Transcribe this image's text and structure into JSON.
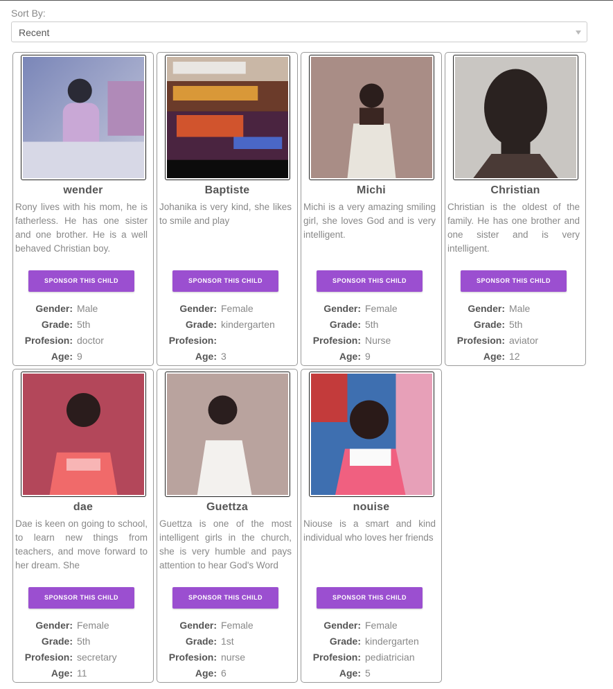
{
  "sort": {
    "label": "Sort By:",
    "selected": "Recent"
  },
  "labels": {
    "sponsor": "SPONSOR THIS CHILD",
    "gender": "Gender:",
    "grade": "Grade:",
    "profesion": "Profesion:",
    "age": "Age:"
  },
  "children": [
    {
      "name": "wender",
      "bio": "Rony lives with his mom, he is fatherless. He has one sister and one brother. He is a well behaved Christian boy.",
      "gender": "Male",
      "grade": "5th",
      "profesion": "doctor",
      "age": "9",
      "photo_icon": "child-photo-boy"
    },
    {
      "name": "Baptiste",
      "bio": "Johanika is very kind, she likes to smile and play",
      "gender": "Female",
      "grade": "kindergarten",
      "profesion": "",
      "age": "3",
      "photo_icon": "orphanage-banner-photo"
    },
    {
      "name": "Michi",
      "bio": "Michi is a very amazing smiling girl, she loves God and is very intelligent.",
      "gender": "Female",
      "grade": "5th",
      "profesion": "Nurse",
      "age": "9",
      "photo_icon": "child-photo-girl"
    },
    {
      "name": "Christian",
      "bio": "Christian is the oldest of the family. He has one brother and one sister and is very intelligent.",
      "gender": "Male",
      "grade": "5th",
      "profesion": "aviator",
      "age": "12",
      "photo_icon": "child-photo-boy"
    },
    {
      "name": "dae",
      "bio": "Dae is keen on going to school, to learn new things from teachers, and move forward to her dream. She",
      "gender": "Female",
      "grade": "5th",
      "profesion": "secretary",
      "age": "11",
      "photo_icon": "child-photo-girl"
    },
    {
      "name": "Guettza",
      "bio": "Guettza is one of the most intelligent girls in the church, she is very humble and pays attention to hear God's Word",
      "gender": "Female",
      "grade": "1st",
      "profesion": "nurse",
      "age": "6",
      "photo_icon": "child-photo-girl"
    },
    {
      "name": "nouise",
      "bio": "Niouse is a smart and kind individual who loves her friends",
      "gender": "Female",
      "grade": "kindergarten",
      "profesion": "pediatrician",
      "age": "5",
      "photo_icon": "child-photo-girl"
    }
  ],
  "colors": {
    "accent": "#9b4fd0"
  }
}
